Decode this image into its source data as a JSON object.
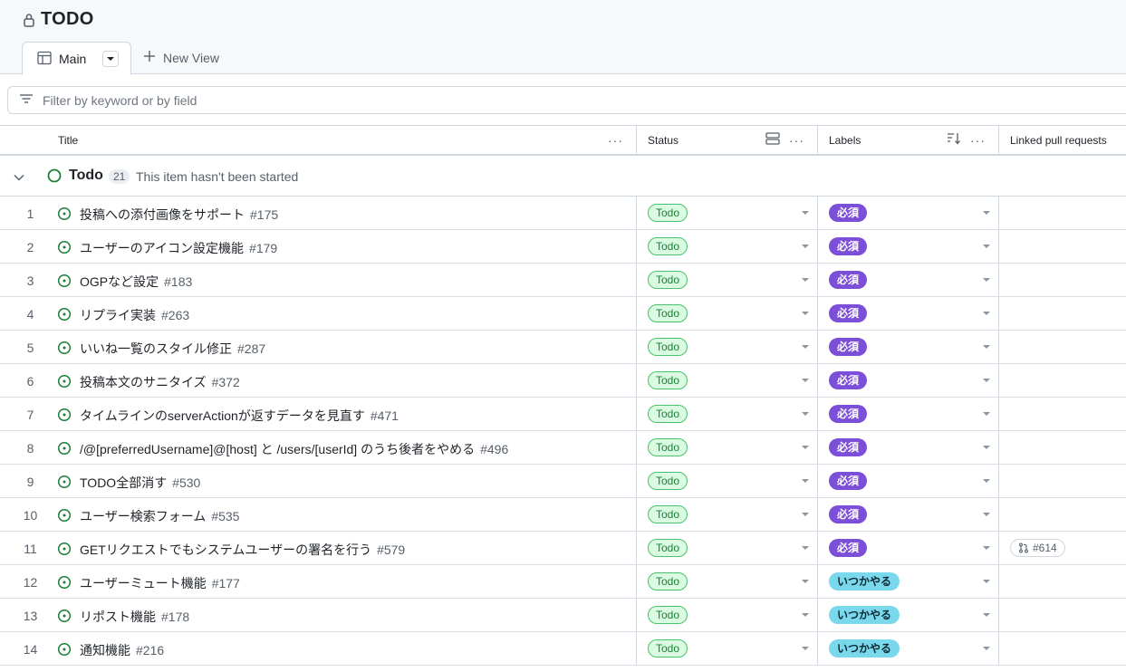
{
  "project": {
    "title": "TODO"
  },
  "views": {
    "main_label": "Main",
    "new_view_label": "New View"
  },
  "filter": {
    "placeholder": "Filter by keyword or by field"
  },
  "columns": {
    "title": "Title",
    "status": "Status",
    "labels": "Labels",
    "linked": "Linked pull requests"
  },
  "group": {
    "name": "Todo",
    "count": "21",
    "description": "This item hasn't been started"
  },
  "colors": {
    "accent_green": "#1a7f37",
    "label_required": "#7c4fd8",
    "label_someday": "#7ad8ec"
  },
  "rows": [
    {
      "n": "1",
      "title": "投稿への添付画像をサポート",
      "num": "#175",
      "status": "Todo",
      "label": "必須",
      "label_kind": "required",
      "pr": ""
    },
    {
      "n": "2",
      "title": "ユーザーのアイコン設定機能",
      "num": "#179",
      "status": "Todo",
      "label": "必須",
      "label_kind": "required",
      "pr": ""
    },
    {
      "n": "3",
      "title": "OGPなど設定",
      "num": "#183",
      "status": "Todo",
      "label": "必須",
      "label_kind": "required",
      "pr": ""
    },
    {
      "n": "4",
      "title": "リプライ実装",
      "num": "#263",
      "status": "Todo",
      "label": "必須",
      "label_kind": "required",
      "pr": ""
    },
    {
      "n": "5",
      "title": "いいね一覧のスタイル修正",
      "num": "#287",
      "status": "Todo",
      "label": "必須",
      "label_kind": "required",
      "pr": ""
    },
    {
      "n": "6",
      "title": "投稿本文のサニタイズ",
      "num": "#372",
      "status": "Todo",
      "label": "必須",
      "label_kind": "required",
      "pr": ""
    },
    {
      "n": "7",
      "title": "タイムラインのserverActionが返すデータを見直す",
      "num": "#471",
      "status": "Todo",
      "label": "必須",
      "label_kind": "required",
      "pr": ""
    },
    {
      "n": "8",
      "title": "/@[preferredUsername]@[host] と /users/[userId] のうち後者をやめる",
      "num": "#496",
      "status": "Todo",
      "label": "必須",
      "label_kind": "required",
      "pr": ""
    },
    {
      "n": "9",
      "title": "TODO全部消す",
      "num": "#530",
      "status": "Todo",
      "label": "必須",
      "label_kind": "required",
      "pr": ""
    },
    {
      "n": "10",
      "title": "ユーザー検索フォーム",
      "num": "#535",
      "status": "Todo",
      "label": "必須",
      "label_kind": "required",
      "pr": ""
    },
    {
      "n": "11",
      "title": "GETリクエストでもシステムユーザーの署名を行う",
      "num": "#579",
      "status": "Todo",
      "label": "必須",
      "label_kind": "required",
      "pr": "#614"
    },
    {
      "n": "12",
      "title": "ユーザーミュート機能",
      "num": "#177",
      "status": "Todo",
      "label": "いつかやる",
      "label_kind": "someday",
      "pr": ""
    },
    {
      "n": "13",
      "title": "リポスト機能",
      "num": "#178",
      "status": "Todo",
      "label": "いつかやる",
      "label_kind": "someday",
      "pr": ""
    },
    {
      "n": "14",
      "title": "通知機能",
      "num": "#216",
      "status": "Todo",
      "label": "いつかやる",
      "label_kind": "someday",
      "pr": ""
    }
  ]
}
